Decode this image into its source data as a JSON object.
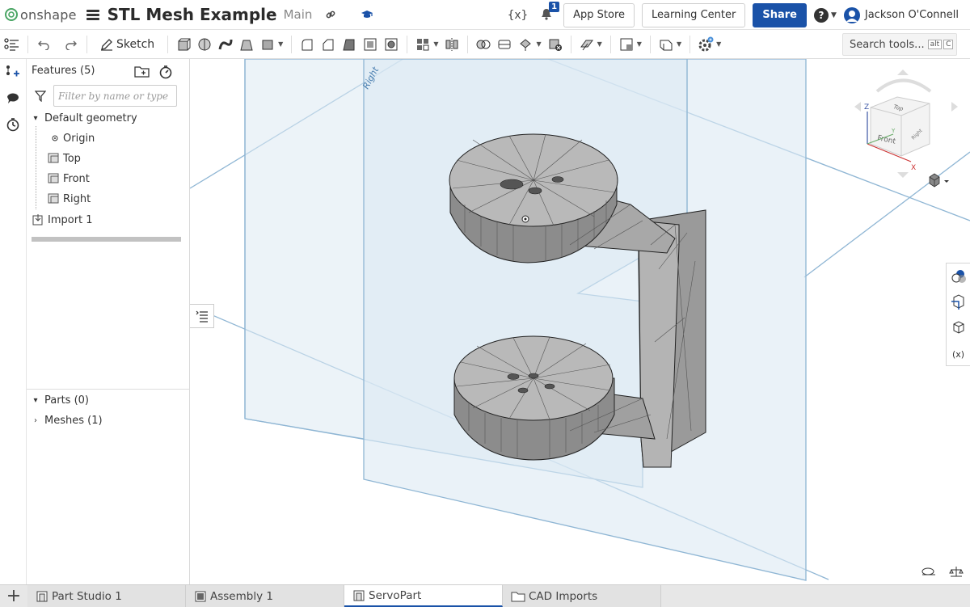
{
  "topbar": {
    "logo_text": "onshape",
    "doc_title": "STL Mesh Example",
    "branch": "Main",
    "variable_icon": "{x}",
    "notification_count": "1",
    "app_store": "App Store",
    "learning_center": "Learning Center",
    "share": "Share",
    "help_symbol": "?",
    "user_name": "Jackson O'Connell"
  },
  "toolbar": {
    "sketch_label": "Sketch",
    "search_placeholder": "Search tools...",
    "shortcut_mod": "alt",
    "shortcut_key": "C",
    "icons": [
      "undo-icon",
      "redo-icon",
      "sketch-icon",
      "extrude-icon",
      "revolve-icon",
      "sweep-icon",
      "loft-icon",
      "thicken-icon",
      "fillet-icon",
      "chamfer-icon",
      "draft-icon",
      "shell-icon",
      "hole-icon",
      "pattern-icon",
      "mirror-icon",
      "boolean-icon",
      "split-icon",
      "transform-icon",
      "delete-part-icon",
      "plane-icon",
      "mate-connector-icon",
      "sheet-metal-icon",
      "custom-features-icon"
    ]
  },
  "features": {
    "header": "Features (5)",
    "filter_placeholder": "Filter by name or type",
    "group_label": "Default geometry",
    "items": [
      {
        "label": "Origin",
        "icon": "origin-icon"
      },
      {
        "label": "Top",
        "icon": "plane-icon"
      },
      {
        "label": "Front",
        "icon": "plane-icon"
      },
      {
        "label": "Right",
        "icon": "plane-icon"
      }
    ],
    "import_label": "Import 1",
    "parts_label": "Parts (0)",
    "meshes_label": "Meshes (1)"
  },
  "viewport": {
    "plane_label_right": "Right",
    "view_cube": {
      "top": "Top",
      "front": "Front",
      "right": "Right",
      "axis_x": "X",
      "axis_y": "Y",
      "axis_z": "Z"
    },
    "right_tools": [
      "appearance-icon",
      "section-view-icon",
      "display-states-icon",
      "variable-table-icon"
    ],
    "variable_table_text": "(x)",
    "mesh_color": "#9a9a9a",
    "plane_color": "#dce9f3"
  },
  "tabs": [
    {
      "label": "Part Studio 1",
      "icon": "part-studio-icon",
      "active": false
    },
    {
      "label": "Assembly 1",
      "icon": "assembly-icon",
      "active": false
    },
    {
      "label": "ServoPart",
      "icon": "part-studio-icon",
      "active": true
    },
    {
      "label": "CAD Imports",
      "icon": "folder-icon",
      "active": false
    }
  ],
  "colors": {
    "accent": "#1a52a8",
    "logo_green": "#4aa564"
  }
}
